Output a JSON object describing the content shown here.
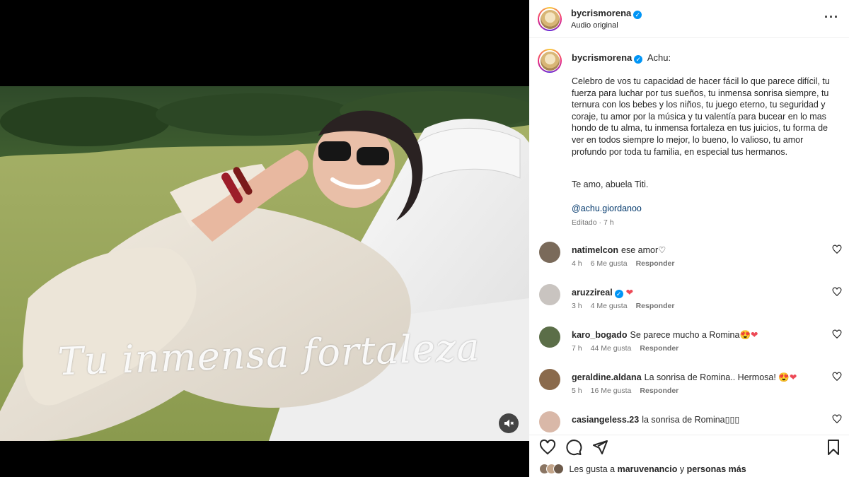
{
  "post": {
    "username": "bycrismorena",
    "audio_label": "Audio original",
    "more_label": "···",
    "overlay_text": "Tu inmensa fortaleza"
  },
  "caption": {
    "username": "bycrismorena",
    "first_line": "Achu:",
    "body": "Celebro de vos tu capacidad de hacer fácil lo que parece difícil, tu fuerza para luchar por tus sueños, tu inmensa sonrisa siempre, tu ternura con los bebes y los niños, tu juego eterno, tu seguridad y coraje, tu amor por la música y tu valentía para bucear en lo mas hondo de tu alma, tu inmensa fortaleza en tus juicios, tu forma de ver en todos siempre lo mejor, lo bueno, lo valioso, tu amor profundo por toda tu familia, en especial tus hermanos.",
    "signoff": "Te amo, abuela Titi.",
    "mention": "@achu.giordanoo",
    "meta": "Editado · 7 h"
  },
  "comments": [
    {
      "user": "natimelcon",
      "text": "ese amor♡",
      "time": "4 h",
      "likes": "6 Me gusta",
      "reply": "Responder",
      "avatar_color": "#7a6a5a",
      "verified": false,
      "emoji": ""
    },
    {
      "user": "aruzzireal",
      "text": "",
      "time": "3 h",
      "likes": "4 Me gusta",
      "reply": "Responder",
      "avatar_color": "#c9c4c0",
      "verified": true,
      "emoji": "❤"
    },
    {
      "user": "karo_bogado",
      "text": "Se parece mucho a Romina",
      "time": "7 h",
      "likes": "44 Me gusta",
      "reply": "Responder",
      "avatar_color": "#5b6e48",
      "verified": false,
      "emoji": "😍❤"
    },
    {
      "user": "geraldine.aldana",
      "text": "La sonrisa de Romina.. Hermosa!",
      "time": "5 h",
      "likes": "16 Me gusta",
      "reply": "Responder",
      "avatar_color": "#8a6a4c",
      "verified": false,
      "emoji": "😍❤"
    },
    {
      "user": "casiangeless.23",
      "text": "la sonrisa de Romina▯▯▯",
      "time": "",
      "likes": "",
      "reply": "",
      "avatar_color": "#d9b8a8",
      "verified": false,
      "emoji": ""
    }
  ],
  "likes": {
    "prefix": "Les gusta a",
    "user": "maruvenancio",
    "middle": "y",
    "suffix": "personas más"
  },
  "icons": [
    "heart-icon",
    "comment-icon",
    "share-icon",
    "bookmark-icon",
    "mute-icon",
    "more-icon",
    "verified-icon"
  ],
  "colors": {
    "verified": "#0095f6",
    "like_red": "#ed4956",
    "link": "#00376b",
    "muted_text": "#737373"
  }
}
